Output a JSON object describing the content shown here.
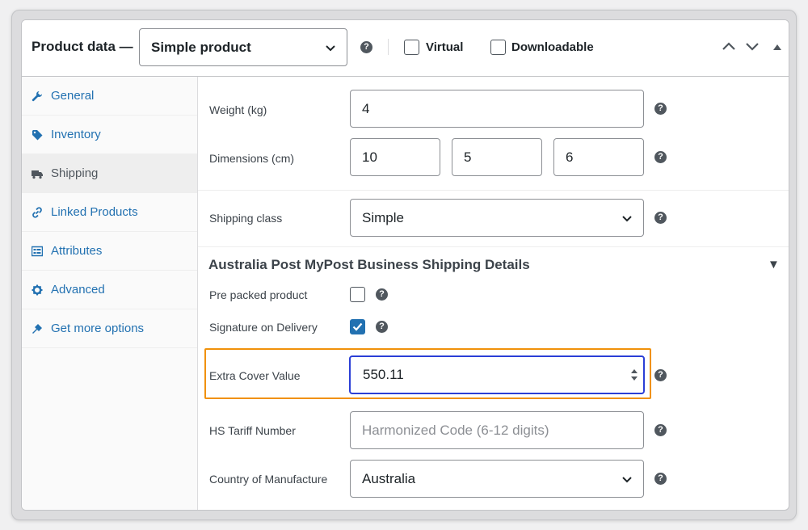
{
  "header": {
    "title": "Product data —",
    "product_type": "Simple product",
    "help": "?",
    "virtual_label": "Virtual",
    "downloadable_label": "Downloadable",
    "virtual_checked": false,
    "downloadable_checked": false
  },
  "sidebar": {
    "items": [
      {
        "label": "General",
        "icon": "wrench-icon",
        "active": false
      },
      {
        "label": "Inventory",
        "icon": "tag-icon",
        "active": false
      },
      {
        "label": "Shipping",
        "icon": "truck-icon",
        "active": true
      },
      {
        "label": "Linked Products",
        "icon": "link-icon",
        "active": false
      },
      {
        "label": "Attributes",
        "icon": "list-icon",
        "active": false
      },
      {
        "label": "Advanced",
        "icon": "gear-icon",
        "active": false
      },
      {
        "label": "Get more options",
        "icon": "plugin-icon",
        "active": false
      }
    ]
  },
  "shipping": {
    "weight_label": "Weight (kg)",
    "weight_value": "4",
    "dimensions_label": "Dimensions (cm)",
    "length_value": "10",
    "width_value": "5",
    "height_value": "6",
    "class_label": "Shipping class",
    "class_value": "Simple"
  },
  "auspost": {
    "section_title": "Australia Post MyPost Business Shipping Details",
    "collapse_glyph": "▼",
    "pre_packed_label": "Pre packed product",
    "pre_packed_checked": false,
    "signature_label": "Signature on Delivery",
    "signature_checked": true,
    "extra_cover_label": "Extra Cover Value",
    "extra_cover_value": "550.11",
    "hs_tariff_label": "HS Tariff Number",
    "hs_tariff_placeholder": "Harmonized Code (6-12 digits)",
    "country_label": "Country of Manufacture",
    "country_value": "Australia"
  },
  "colors": {
    "link": "#2271b1",
    "highlight": "#f0910a",
    "focus": "#2b3fd6"
  }
}
